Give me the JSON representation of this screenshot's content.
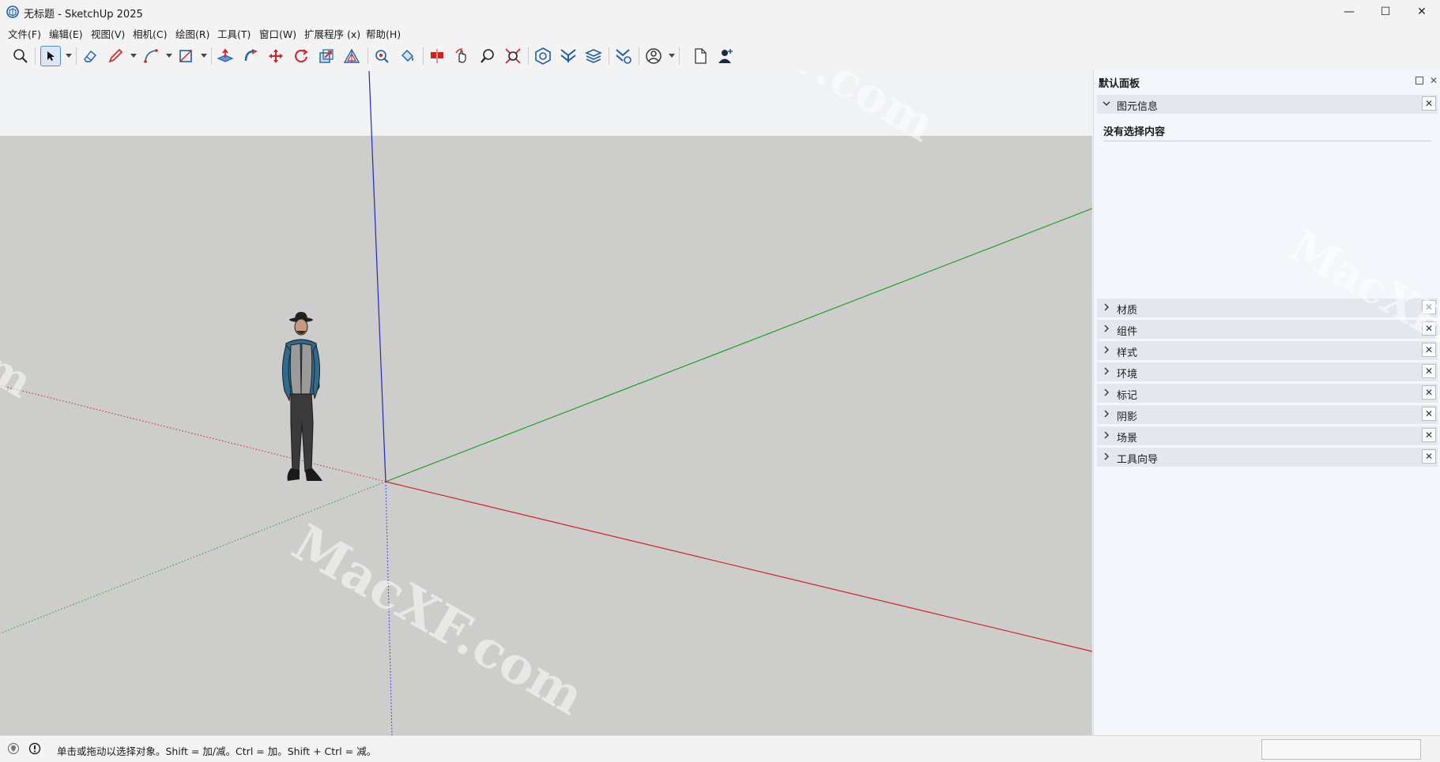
{
  "window": {
    "title": "无标题 - SketchUp 2025",
    "minimize": "—",
    "maximize": "☐",
    "close": "✕"
  },
  "menu": [
    "文件(F)",
    "编辑(E)",
    "视图(V)",
    "相机(C)",
    "绘图(R)",
    "工具(T)",
    "窗口(W)",
    "扩展程序 (x)",
    "帮助(H)"
  ],
  "toolbar": {
    "tools": [
      "zoom-icon",
      "select-icon",
      "eraser-icon",
      "pencil-icon",
      "arc-icon",
      "rectangle-icon",
      "push-pull-icon",
      "follow-me-icon",
      "move-icon",
      "rotate-icon",
      "scale-icon",
      "offset-icon",
      "tape-measure-icon",
      "paint-bucket-icon",
      "section-plane-icon",
      "orbit-icon",
      "pan-icon",
      "zoom-extents-icon",
      "warehouse-icon",
      "extension-warehouse-icon",
      "layout-icon",
      "trimble-connect-icon",
      "profile-icon",
      "new-file-icon",
      "add-user-icon"
    ]
  },
  "panel": {
    "title": "默认面板",
    "entity_info": {
      "label": "图元信息",
      "content": "没有选择内容"
    },
    "sections": [
      "材质",
      "组件",
      "样式",
      "环境",
      "标记",
      "阴影",
      "场景",
      "工具向导"
    ]
  },
  "status": {
    "text": "单击或拖动以选择对象。Shift = 加/减。Ctrl = 加。Shift + Ctrl = 减。"
  },
  "watermark": "MacXF.com",
  "colors": {
    "axis_red": "#d42020",
    "axis_green": "#1aa51a",
    "axis_blue": "#2323c8",
    "ground": "#cdcdcb",
    "sky": "#f0f2f4",
    "accent": "#1d6fd6"
  }
}
